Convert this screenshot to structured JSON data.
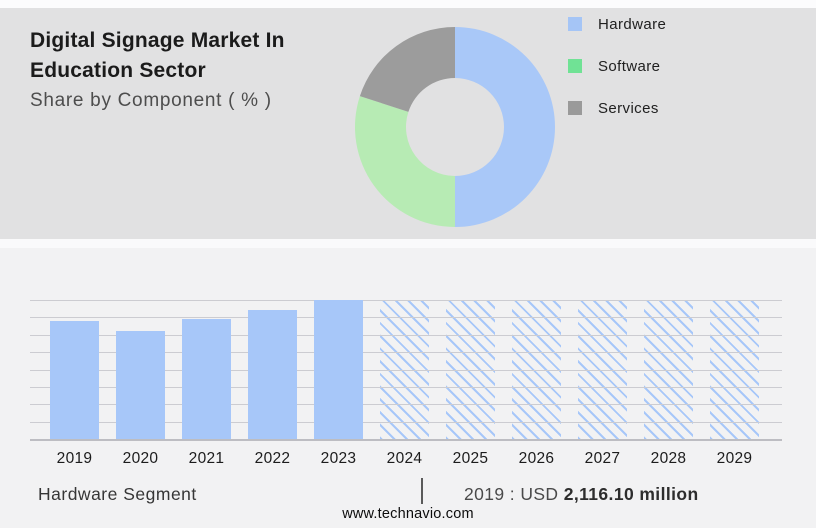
{
  "header": {
    "title_line1": "Digital Signage Market In",
    "title_line2": "Education Sector",
    "subtitle": "Share by Component ( % )"
  },
  "chart_data": [
    {
      "type": "pie",
      "subtype": "donut",
      "title": "Share by Component ( % )",
      "labels": [
        "Hardware",
        "Software",
        "Services"
      ],
      "values": [
        50,
        30,
        20
      ],
      "unit": "%",
      "value_labels_shown": false,
      "note": "segment shares estimated from arc angles; no numeric labels shown in image",
      "donut_colors": [
        "#a9c8f8",
        "#b7ebb4",
        "#9c9c9c"
      ],
      "legend_colors": [
        "#a5c5f6",
        "#70e295",
        "#9a9a9a"
      ],
      "legend_position": "right",
      "hole_ratio": 0.49,
      "start_angle_deg_clockwise_from_top": 0
    },
    {
      "type": "bar",
      "title": "Hardware Segment",
      "categories": [
        "2019",
        "2020",
        "2021",
        "2022",
        "2023",
        "2024",
        "2025",
        "2026",
        "2027",
        "2028",
        "2029"
      ],
      "series": [
        {
          "name": "Hardware segment market size",
          "relative_heights_max1": [
            0.85,
            0.78,
            0.86,
            0.93,
            1.0,
            1.0,
            1.0,
            1.0,
            1.0,
            1.0,
            1.0
          ],
          "forecast_mask": [
            false,
            false,
            false,
            false,
            false,
            true,
            true,
            true,
            true,
            true,
            true
          ]
        }
      ],
      "known_value": {
        "year": "2019",
        "text": "USD 2,116.10 million"
      },
      "y_axis_labels_shown": false,
      "xlabel": "",
      "ylabel": "",
      "grid": true,
      "gridline_count": 9,
      "bar_color": "#a7c7f9",
      "forecast_style": "diagonal-hatch"
    }
  ],
  "footer": {
    "segment_label": "Hardware Segment",
    "separator": "|",
    "value_prefix": "2019 : USD",
    "value_bold": "2,116.10 million",
    "website": "www.technavio.com"
  },
  "colors": {
    "header_bg": "#e1e1e2",
    "body_bg": "#f2f2f3",
    "gridline": "#ccccd1",
    "bar_blue": "#a7c7f9"
  }
}
